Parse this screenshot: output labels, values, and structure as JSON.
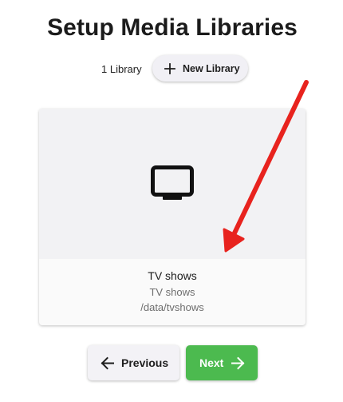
{
  "page": {
    "title": "Setup Media Libraries",
    "library_count": "1 Library",
    "new_library_label": "New Library"
  },
  "library_card": {
    "icon": "tv-icon",
    "title": "TV shows",
    "type": "TV shows",
    "path": "/data/tvshows"
  },
  "footer": {
    "previous_label": "Previous",
    "next_label": "Next"
  },
  "colors": {
    "next_button": "#4cba4f",
    "annotation_arrow": "#e8231e"
  }
}
